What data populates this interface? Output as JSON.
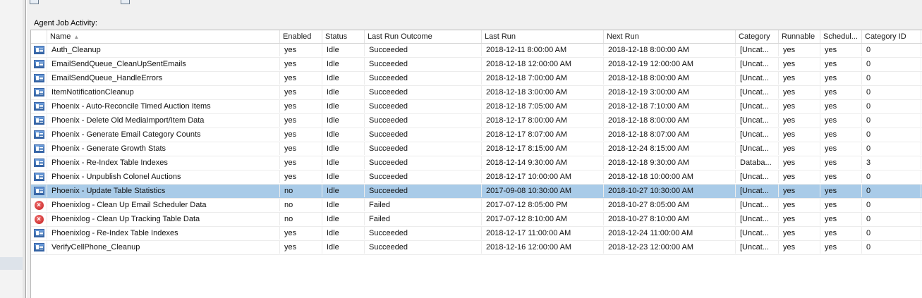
{
  "panel": {
    "section_label": "Agent Job Activity:"
  },
  "grid": {
    "columns": [
      "Name",
      "Enabled",
      "Status",
      "Last Run Outcome",
      "Last Run",
      "Next Run",
      "Category",
      "Runnable",
      "Schedul...",
      "Category ID"
    ],
    "sort_column": "Name",
    "sort_direction": "ascending",
    "selected_row": 10,
    "rows": [
      {
        "icon": "job-icon",
        "name": "Auth_Cleanup",
        "enabled": "yes",
        "status": "Idle",
        "outcome": "Succeeded",
        "last_run": "2018-12-11 8:00:00 AM",
        "next_run": "2018-12-18 8:00:00 AM",
        "category": "[Uncat...",
        "runnable": "yes",
        "scheduled": "yes",
        "category_id": "0"
      },
      {
        "icon": "job-icon",
        "name": "EmailSendQueue_CleanUpSentEmails",
        "enabled": "yes",
        "status": "Idle",
        "outcome": "Succeeded",
        "last_run": "2018-12-18 12:00:00 AM",
        "next_run": "2018-12-19 12:00:00 AM",
        "category": "[Uncat...",
        "runnable": "yes",
        "scheduled": "yes",
        "category_id": "0"
      },
      {
        "icon": "job-icon",
        "name": "EmailSendQueue_HandleErrors",
        "enabled": "yes",
        "status": "Idle",
        "outcome": "Succeeded",
        "last_run": "2018-12-18 7:00:00 AM",
        "next_run": "2018-12-18 8:00:00 AM",
        "category": "[Uncat...",
        "runnable": "yes",
        "scheduled": "yes",
        "category_id": "0"
      },
      {
        "icon": "job-icon",
        "name": "ItemNotificationCleanup",
        "enabled": "yes",
        "status": "Idle",
        "outcome": "Succeeded",
        "last_run": "2018-12-18 3:00:00 AM",
        "next_run": "2018-12-19 3:00:00 AM",
        "category": "[Uncat...",
        "runnable": "yes",
        "scheduled": "yes",
        "category_id": "0"
      },
      {
        "icon": "job-icon",
        "name": "Phoenix - Auto-Reconcile Timed Auction Items",
        "enabled": "yes",
        "status": "Idle",
        "outcome": "Succeeded",
        "last_run": "2018-12-18 7:05:00 AM",
        "next_run": "2018-12-18 7:10:00 AM",
        "category": "[Uncat...",
        "runnable": "yes",
        "scheduled": "yes",
        "category_id": "0"
      },
      {
        "icon": "job-icon",
        "name": "Phoenix - Delete Old MediaImport/Item Data",
        "enabled": "yes",
        "status": "Idle",
        "outcome": "Succeeded",
        "last_run": "2018-12-17 8:00:00 AM",
        "next_run": "2018-12-18 8:00:00 AM",
        "category": "[Uncat...",
        "runnable": "yes",
        "scheduled": "yes",
        "category_id": "0"
      },
      {
        "icon": "job-icon",
        "name": "Phoenix - Generate Email Category Counts",
        "enabled": "yes",
        "status": "Idle",
        "outcome": "Succeeded",
        "last_run": "2018-12-17 8:07:00 AM",
        "next_run": "2018-12-18 8:07:00 AM",
        "category": "[Uncat...",
        "runnable": "yes",
        "scheduled": "yes",
        "category_id": "0"
      },
      {
        "icon": "job-icon",
        "name": "Phoenix - Generate Growth Stats",
        "enabled": "yes",
        "status": "Idle",
        "outcome": "Succeeded",
        "last_run": "2018-12-17 8:15:00 AM",
        "next_run": "2018-12-24 8:15:00 AM",
        "category": "[Uncat...",
        "runnable": "yes",
        "scheduled": "yes",
        "category_id": "0"
      },
      {
        "icon": "job-icon",
        "name": "Phoenix - Re-Index Table Indexes",
        "enabled": "yes",
        "status": "Idle",
        "outcome": "Succeeded",
        "last_run": "2018-12-14 9:30:00 AM",
        "next_run": "2018-12-18 9:30:00 AM",
        "category": "Databa...",
        "runnable": "yes",
        "scheduled": "yes",
        "category_id": "3"
      },
      {
        "icon": "job-icon",
        "name": "Phoenix - Unpublish Colonel Auctions",
        "enabled": "yes",
        "status": "Idle",
        "outcome": "Succeeded",
        "last_run": "2018-12-17 10:00:00 AM",
        "next_run": "2018-12-18 10:00:00 AM",
        "category": "[Uncat...",
        "runnable": "yes",
        "scheduled": "yes",
        "category_id": "0"
      },
      {
        "icon": "job-icon",
        "name": "Phoenix - Update Table Statistics",
        "enabled": "no",
        "status": "Idle",
        "outcome": "Succeeded",
        "last_run": "2017-09-08 10:30:00 AM",
        "next_run": "2018-10-27 10:30:00 AM",
        "category": "[Uncat...",
        "runnable": "yes",
        "scheduled": "yes",
        "category_id": "0"
      },
      {
        "icon": "fail-icon",
        "name": "Phoenixlog - Clean Up Email Scheduler Data",
        "enabled": "no",
        "status": "Idle",
        "outcome": "Failed",
        "last_run": "2017-07-12 8:05:00 PM",
        "next_run": "2018-10-27 8:05:00 AM",
        "category": "[Uncat...",
        "runnable": "yes",
        "scheduled": "yes",
        "category_id": "0"
      },
      {
        "icon": "fail-icon",
        "name": "Phoenixlog - Clean Up Tracking Table Data",
        "enabled": "no",
        "status": "Idle",
        "outcome": "Failed",
        "last_run": "2017-07-12 8:10:00 AM",
        "next_run": "2018-10-27 8:10:00 AM",
        "category": "[Uncat...",
        "runnable": "yes",
        "scheduled": "yes",
        "category_id": "0"
      },
      {
        "icon": "job-icon",
        "name": "Phoenixlog - Re-Index Table Indexes",
        "enabled": "yes",
        "status": "Idle",
        "outcome": "Succeeded",
        "last_run": "2018-12-17 11:00:00 AM",
        "next_run": "2018-12-24 11:00:00 AM",
        "category": "[Uncat...",
        "runnable": "yes",
        "scheduled": "yes",
        "category_id": "0"
      },
      {
        "icon": "job-icon",
        "name": "VerifyCellPhone_Cleanup",
        "enabled": "yes",
        "status": "Idle",
        "outcome": "Succeeded",
        "last_run": "2018-12-16 12:00:00 AM",
        "next_run": "2018-12-23 12:00:00 AM",
        "category": "[Uncat...",
        "runnable": "yes",
        "scheduled": "yes",
        "category_id": "0"
      }
    ]
  }
}
